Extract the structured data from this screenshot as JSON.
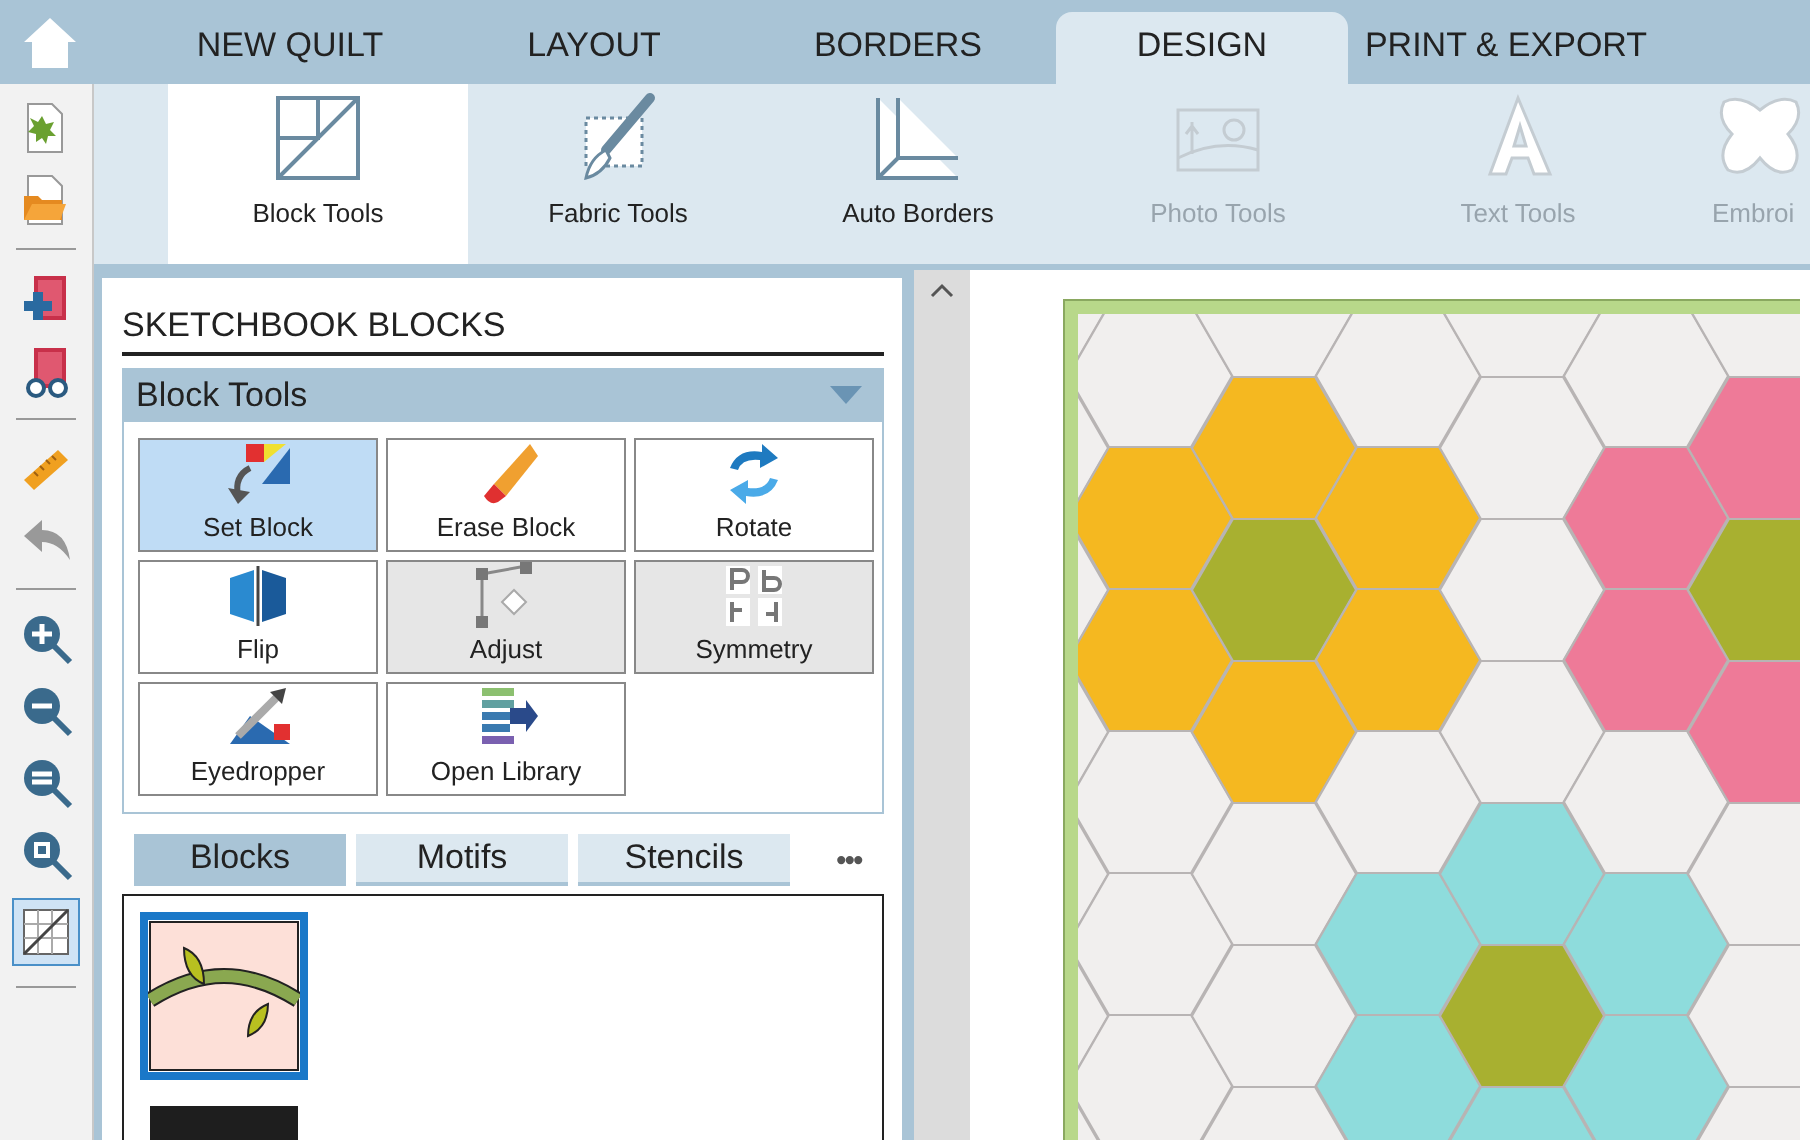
{
  "tabs": [
    {
      "label": "NEW QUILT",
      "selected": false
    },
    {
      "label": "LAYOUT",
      "selected": false
    },
    {
      "label": "BORDERS",
      "selected": false
    },
    {
      "label": "DESIGN",
      "selected": true
    },
    {
      "label": "PRINT & EXPORT",
      "selected": false
    }
  ],
  "ribbon": [
    {
      "label": "Block Tools",
      "selected": true,
      "disabled": false
    },
    {
      "label": "Fabric Tools",
      "selected": false,
      "disabled": false
    },
    {
      "label": "Auto Borders",
      "selected": false,
      "disabled": false
    },
    {
      "label": "Photo Tools",
      "selected": false,
      "disabled": true
    },
    {
      "label": "Text Tools",
      "selected": false,
      "disabled": true
    },
    {
      "label": "Embroi",
      "selected": false,
      "disabled": true
    }
  ],
  "left_toolbar": {
    "show_grid": true
  },
  "panel": {
    "title": "SKETCHBOOK BLOCKS",
    "section": {
      "title": "Block Tools",
      "expanded": true
    },
    "tools": [
      {
        "label": "Set Block",
        "selected": true,
        "disabled": false
      },
      {
        "label": "Erase Block",
        "selected": false,
        "disabled": false
      },
      {
        "label": "Rotate",
        "selected": false,
        "disabled": false
      },
      {
        "label": "Flip",
        "selected": false,
        "disabled": false
      },
      {
        "label": "Adjust",
        "selected": false,
        "disabled": true
      },
      {
        "label": "Symmetry",
        "selected": false,
        "disabled": true
      },
      {
        "label": "Eyedropper",
        "selected": false,
        "disabled": false
      },
      {
        "label": "Open Library",
        "selected": false,
        "disabled": false
      }
    ],
    "library_tabs": [
      {
        "label": "Blocks",
        "selected": true
      },
      {
        "label": "Motifs",
        "selected": false
      },
      {
        "label": "Stencils",
        "selected": false
      }
    ],
    "more": "•••",
    "blocks": [
      {
        "selected": true
      },
      {
        "selected": false
      }
    ]
  }
}
